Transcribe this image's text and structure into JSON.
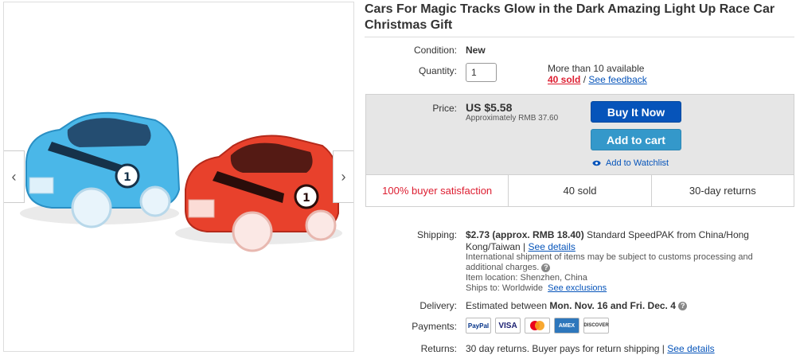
{
  "title": "Cars For Magic Tracks Glow in the Dark Amazing Light Up Race Car Christmas Gift",
  "condition": {
    "label": "Condition:",
    "value": "New"
  },
  "quantity": {
    "label": "Quantity:",
    "value": "1",
    "available": "More than 10 available",
    "sold": "40 sold",
    "separator": "/",
    "feedback": "See feedback"
  },
  "price": {
    "label": "Price:",
    "value": "US $5.58",
    "approx": "Approximately RMB 37.60"
  },
  "buttons": {
    "buy": "Buy It Now",
    "cart": "Add to cart",
    "watch": "Add to Watchlist"
  },
  "stats": [
    "100% buyer satisfaction",
    "40 sold",
    "30-day returns"
  ],
  "shipping": {
    "label": "Shipping:",
    "price": "$2.73 (approx. RMB 18.40)",
    "service": "Standard SpeedPAK from China/Hong Kong/Taiwan",
    "details": "See details",
    "note": "International shipment of items may be subject to customs processing and additional charges.",
    "location_label": "Item location:",
    "location": "Shenzhen, China",
    "ships_label": "Ships to:",
    "ships": "Worldwide",
    "exclusions": "See exclusions"
  },
  "delivery": {
    "label": "Delivery:",
    "prefix": "Estimated between",
    "range": "Mon. Nov. 16 and Fri. Dec. 4"
  },
  "payments": {
    "label": "Payments:",
    "cards": [
      "PayPal",
      "VISA",
      "MasterCard",
      "AMEX",
      "DISCOVER"
    ]
  },
  "returns": {
    "label": "Returns:",
    "text": "30 day returns. Buyer pays for return shipping |",
    "details": "See details"
  },
  "icons": {
    "prev": "chevron-left-icon",
    "next": "chevron-right-icon",
    "watch": "eye-icon",
    "info": "info-icon"
  },
  "colors": {
    "buy_button": "#0654ba",
    "cart_button": "#3498ca",
    "sold_red": "#dd1e31",
    "link_blue": "#0654ba"
  }
}
